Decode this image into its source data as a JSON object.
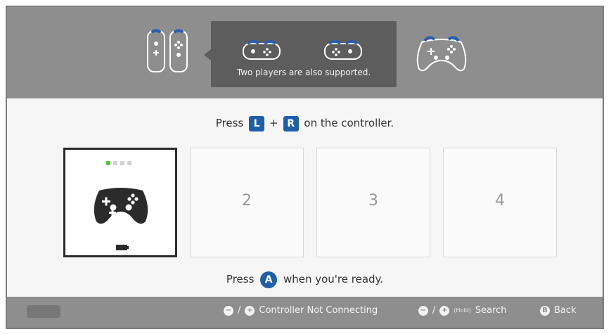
{
  "tooltip": {
    "text": "Two players are also supported."
  },
  "prompt": {
    "press": "Press",
    "key_l": "L",
    "plus": "+",
    "key_r": "R",
    "suffix": "on the controller."
  },
  "slots": [
    {
      "label": ""
    },
    {
      "label": "2"
    },
    {
      "label": "3"
    },
    {
      "label": "4"
    }
  ],
  "ready": {
    "press": "Press",
    "key_a": "A",
    "suffix": "when you're ready."
  },
  "footer": {
    "minus": "−",
    "slash": "/",
    "plus": "+",
    "controller_not_connecting": "Controller Not Connecting",
    "hold": "(Hold)",
    "search": "Search",
    "b_key": "B",
    "back": "Back"
  },
  "colors": {
    "topbar": "#8e8e8e",
    "key_blue": "#1f5fa8",
    "led_on": "#5cc63d",
    "tooltip_bg": "#5d5d5d"
  }
}
